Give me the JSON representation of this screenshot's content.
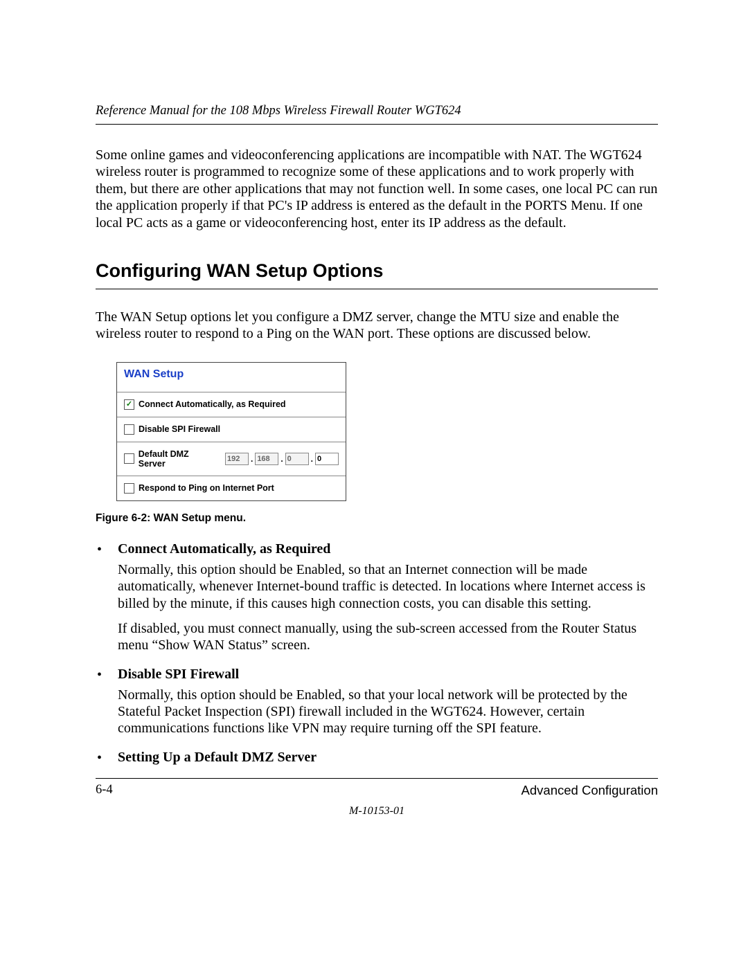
{
  "header": {
    "running": "Reference Manual for the 108 Mbps Wireless Firewall Router WGT624"
  },
  "intro": "Some online games and videoconferencing applications are incompatible with NAT. The WGT624 wireless router is programmed to recognize some of these applications and to work properly with them, but there are other applications that may not function well. In some cases, one local PC can run the application properly if that PC's IP address is entered as the default in the PORTS Menu. If one local PC acts as a game or videoconferencing host, enter its IP address as the default.",
  "section_heading": "Configuring WAN Setup Options",
  "section_intro": "The WAN Setup options let you configure a DMZ server, change the MTU size and enable the wireless router to respond to a Ping on the WAN port. These options are discussed below.",
  "wan_panel": {
    "title": "WAN Setup",
    "rows": {
      "connect_auto": {
        "label": "Connect Automatically, as Required",
        "checked": true
      },
      "disable_spi": {
        "label": "Disable SPI Firewall",
        "checked": false
      },
      "dmz": {
        "label": "Default DMZ Server",
        "checked": false,
        "ip": {
          "o1": "192",
          "o2": "168",
          "o3": "0",
          "o4": "0"
        }
      },
      "respond_ping": {
        "label": "Respond to Ping on Internet Port",
        "checked": false
      }
    }
  },
  "figure_caption": "Figure 6-2:  WAN Setup menu.",
  "bullets": [
    {
      "head": "Connect Automatically, as Required",
      "paras": [
        "Normally, this option should be Enabled, so that an Internet connection will be made automatically, whenever Internet-bound traffic is detected. In locations where Internet access is billed by the minute, if this causes high connection costs, you can disable this setting.",
        "If disabled, you must connect manually, using the sub-screen accessed from the Router Status menu “Show WAN Status” screen."
      ]
    },
    {
      "head": "Disable SPI Firewall",
      "paras": [
        "Normally, this option should be Enabled, so that your local network will be protected by the Stateful Packet Inspection (SPI) firewall included in the WGT624. However, certain communications functions like VPN may require turning off the SPI feature."
      ]
    },
    {
      "head": "Setting Up a Default DMZ Server",
      "paras": []
    }
  ],
  "footer": {
    "page_num": "6-4",
    "section": "Advanced Configuration",
    "doc_num": "M-10153-01"
  },
  "glyphs": {
    "bullet": "•",
    "check": "✓"
  }
}
